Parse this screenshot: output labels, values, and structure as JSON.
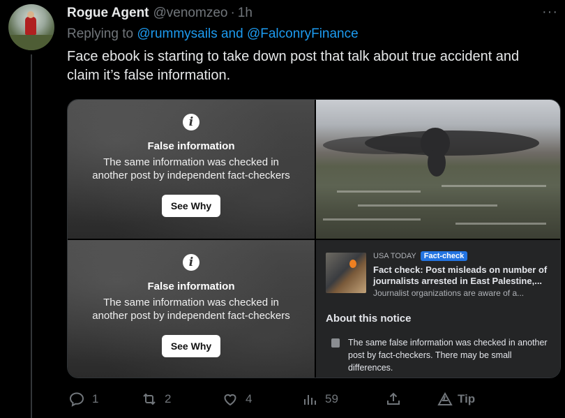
{
  "tweet": {
    "author_name": "Rogue Agent",
    "handle": "@venomzeo",
    "separator": "·",
    "time": "1h",
    "more_label": "···",
    "reply_prefix": "Replying to",
    "reply_mentions": "@rummysails and @FalconryFinance",
    "text": "Face ebook is starting to take down post that talk about true accident and claim it’s false information."
  },
  "media": {
    "false_info": {
      "icon_glyph": "i",
      "title": "False information",
      "line1": "The same information was checked in",
      "line2": "another post by independent fact-checkers",
      "button": "See Why"
    },
    "fact_check": {
      "source": "USA TODAY",
      "badge": "Fact-check",
      "headline": "Fact check: Post misleads on number of journalists arrested in East Palestine,...",
      "subline": "Journalist organizations are aware of a...",
      "about_heading": "About this notice",
      "notice": "The same false information was checked in another post by fact-checkers. There may be small differences."
    }
  },
  "actions": {
    "reply_count": "1",
    "retweet_count": "2",
    "like_count": "4",
    "views_count": "59",
    "tip_label": "Tip"
  },
  "colors": {
    "link": "#1d9bf0",
    "muted": "#71767b",
    "text": "#e7e9ea",
    "fact_check_badge": "#2374e1",
    "fb_panel": "#242526"
  }
}
